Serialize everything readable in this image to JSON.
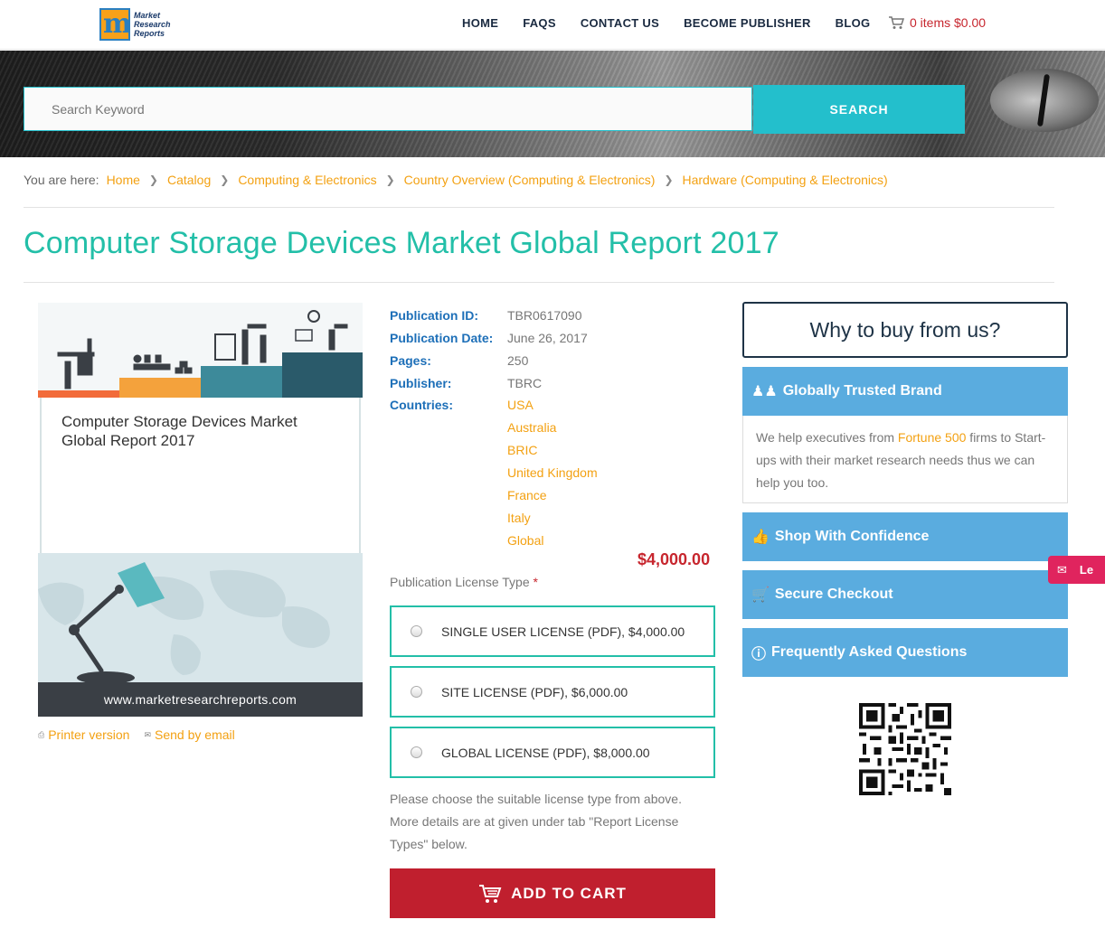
{
  "header": {
    "logo_text": [
      "Market",
      "Research",
      "Reports"
    ],
    "nav": [
      "HOME",
      "FAQS",
      "CONTACT US",
      "BECOME PUBLISHER",
      "BLOG"
    ],
    "cart_text": "0 items $0.00"
  },
  "search": {
    "placeholder": "Search Keyword",
    "button_label": "SEARCH"
  },
  "breadcrumb": {
    "prefix": "You are here:",
    "items": [
      "Home",
      "Catalog",
      "Computing & Electronics",
      "Country Overview (Computing & Electronics)",
      "Hardware (Computing & Electronics)"
    ]
  },
  "page_title": "Computer Storage Devices Market Global Report 2017",
  "cover": {
    "title": "Computer Storage Devices Market Global Report 2017",
    "footer_url": "www.marketresearchreports.com"
  },
  "links": {
    "printer": "Printer version",
    "email": "Send by email"
  },
  "details": {
    "publication_id_label": "Publication ID:",
    "publication_id": "TBR0617090",
    "publication_date_label": "Publication Date:",
    "publication_date": "June 26, 2017",
    "pages_label": "Pages:",
    "pages": "250",
    "publisher_label": "Publisher:",
    "publisher": "TBRC",
    "countries_label": "Countries:",
    "countries": [
      "USA",
      "Australia",
      "BRIC",
      "United Kingdom",
      "France",
      "Italy",
      "Global"
    ]
  },
  "price": "$4,000.00",
  "license": {
    "label": "Publication License Type",
    "required_mark": "*",
    "options": [
      "SINGLE USER LICENSE (PDF), $4,000.00",
      "SITE LICENSE (PDF), $6,000.00",
      "GLOBAL LICENSE (PDF), $8,000.00"
    ],
    "help": "Please choose the suitable license type from above. More details are at given under tab \"Report License Types\" below."
  },
  "add_to_cart": "ADD TO CART",
  "sidebar": {
    "why_title": "Why to buy from us?",
    "trusted_title": "Globally Trusted Brand",
    "trusted_pre": "We help executives from ",
    "trusted_highlight": "Fortune 500",
    "trusted_post": " firms to Start-ups with their market research needs thus we can help you too.",
    "shop_confidence": "Shop With Confidence",
    "secure_checkout": "Secure Checkout",
    "faq": "Frequently Asked Questions"
  },
  "float_tab_text": "Le",
  "colors": {
    "accent_teal": "#23bfcc",
    "title_teal": "#23bfa8",
    "link_orange": "#f3a112",
    "price_red": "#c7262e",
    "side_blue": "#5aacdf",
    "label_blue": "#1d6fb8"
  }
}
